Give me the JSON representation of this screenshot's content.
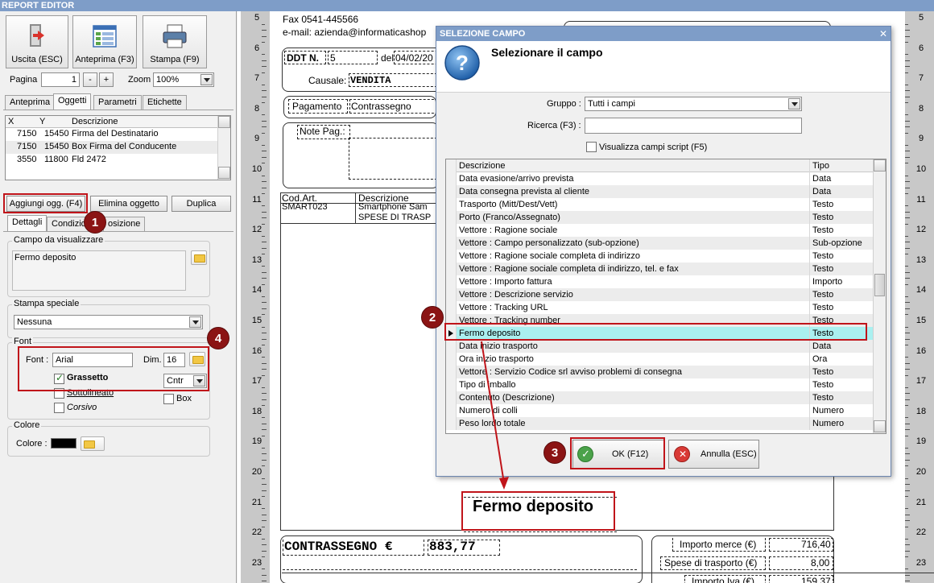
{
  "app": {
    "title": "REPORT EDITOR"
  },
  "toolbar": {
    "exit_label": "Uscita (ESC)",
    "preview_label": "Anteprima (F3)",
    "print_label": "Stampa (F9)",
    "page_label": "Pagina",
    "page_value": "1",
    "minus": "-",
    "plus": "+",
    "zoom_label": "Zoom",
    "zoom_value": "100%"
  },
  "tabs": [
    "Anteprima",
    "Oggetti",
    "Parametri",
    "Etichette"
  ],
  "objects_table": {
    "headers": [
      "X",
      "Y",
      "Descrizione"
    ],
    "rows": [
      {
        "x": "7150",
        "y": "15450",
        "desc": "Firma del Destinatario"
      },
      {
        "x": "7150",
        "y": "15450",
        "desc": "Box Firma del Conducente"
      },
      {
        "x": "3550",
        "y": "11800",
        "desc": "Fld 2472"
      }
    ]
  },
  "object_buttons": {
    "add": "Aggiungi ogg. (F4)",
    "delete": "Elimina oggetto",
    "duplicate": "Duplica"
  },
  "subtabs": [
    "Dettagli",
    "Condizio",
    "osizione"
  ],
  "details": {
    "field_group_title": "Campo da visualizzare",
    "field_value": "Fermo deposito",
    "special_print_title": "Stampa speciale",
    "special_print_value": "Nessuna",
    "font_group_title": "Font",
    "font_label": "Font :",
    "font_value": "Arial",
    "dim_label": "Dim.",
    "dim_value": "16",
    "bold_label": "Grassetto",
    "underline_label": "Sottolineato",
    "italic_label": "Corsivo",
    "align_value": "Cntr",
    "box_label": "Box",
    "color_group_title": "Colore",
    "color_label": "Colore :"
  },
  "markers": [
    "1",
    "2",
    "3",
    "4"
  ],
  "ruler": {
    "numbers": [
      "5",
      "6",
      "7",
      "8",
      "9",
      "10",
      "11",
      "12",
      "13",
      "14",
      "15",
      "16",
      "17",
      "18",
      "19",
      "20",
      "21",
      "22",
      "23"
    ]
  },
  "document": {
    "fax": "Fax 0541-445566",
    "email": "e-mail: azienda@informaticashop",
    "ddt_label": "DDT N.",
    "ddt_value": "5",
    "del_label": "del",
    "del_value": "04/02/20",
    "causale_label": "Causale:",
    "causale_value": "VENDITA",
    "pagamento_label": "Pagamento",
    "pagamento_value": "Contrassegno",
    "note_label": "Note Pag.:",
    "cod_art_header": "Cod.Art.",
    "descr_header": "Descrizione",
    "row1_code": "SMART023",
    "row1_desc": "Smartphone Sam",
    "row2_desc": "SPESE DI TRASP",
    "fermo_deposito": "Fermo deposito",
    "contrassegno_label": "CONTRASSEGNO €",
    "contrassegno_value": "883,77",
    "importo_merce_label": "Importo merce (€)",
    "importo_merce_value": "716,40",
    "spese_trasporto_label": "Spese di trasporto (€)",
    "spese_trasporto_value": "8,00",
    "importo_iva_label": "Importo Iva (€)",
    "importo_iva_value": "159,37"
  },
  "dialog": {
    "title": "SELEZIONE CAMPO",
    "heading": "Selezionare il campo",
    "group_label": "Gruppo :",
    "group_value": "Tutti i campi",
    "search_label": "Ricerca (F3) :",
    "search_value": "",
    "script_checkbox_label": "Visualizza campi script (F5)",
    "grid_headers": {
      "desc": "Descrizione",
      "type": "Tipo"
    },
    "rows": [
      {
        "desc": "Data evasione/arrivo prevista",
        "type": "Data"
      },
      {
        "desc": "Data consegna prevista al cliente",
        "type": "Data"
      },
      {
        "desc": "Trasporto (Mitt/Dest/Vett)",
        "type": "Testo"
      },
      {
        "desc": "Porto (Franco/Assegnato)",
        "type": "Testo"
      },
      {
        "desc": "Vettore : Ragione sociale",
        "type": "Testo"
      },
      {
        "desc": "Vettore : Campo personalizzato (sub-opzione)",
        "type": "Sub-opzione"
      },
      {
        "desc": "Vettore : Ragione sociale completa di indirizzo",
        "type": "Testo"
      },
      {
        "desc": "Vettore : Ragione sociale completa di indirizzo, tel. e fax",
        "type": "Testo"
      },
      {
        "desc": "Vettore : Importo fattura",
        "type": "Importo"
      },
      {
        "desc": "Vettore : Descrizione servizio",
        "type": "Testo"
      },
      {
        "desc": "Vettore : Tracking URL",
        "type": "Testo"
      },
      {
        "desc": "Vettore : Tracking number",
        "type": "Testo"
      },
      {
        "desc": "Fermo deposito",
        "type": "Testo"
      },
      {
        "desc": "Data inizio trasporto",
        "type": "Data"
      },
      {
        "desc": "Ora inizio trasporto",
        "type": "Ora"
      },
      {
        "desc": "Vettore : Servizio Codice srl avviso problemi di consegna",
        "type": "Testo"
      },
      {
        "desc": "Tipo di imballo",
        "type": "Testo"
      },
      {
        "desc": "Contenuto (Descrizione)",
        "type": "Testo"
      },
      {
        "desc": "Numero di colli",
        "type": "Numero"
      },
      {
        "desc": "Peso lordo totale",
        "type": "Numero"
      }
    ],
    "ok_label": "OK (F12)",
    "cancel_label": "Annulla (ESC)",
    "close_glyph": "✕"
  },
  "colors": {
    "titlebar": "#7e9dc8",
    "marker": "#8b1414",
    "highlight": "#c0141a",
    "selected_row": "#aaf0f0"
  }
}
